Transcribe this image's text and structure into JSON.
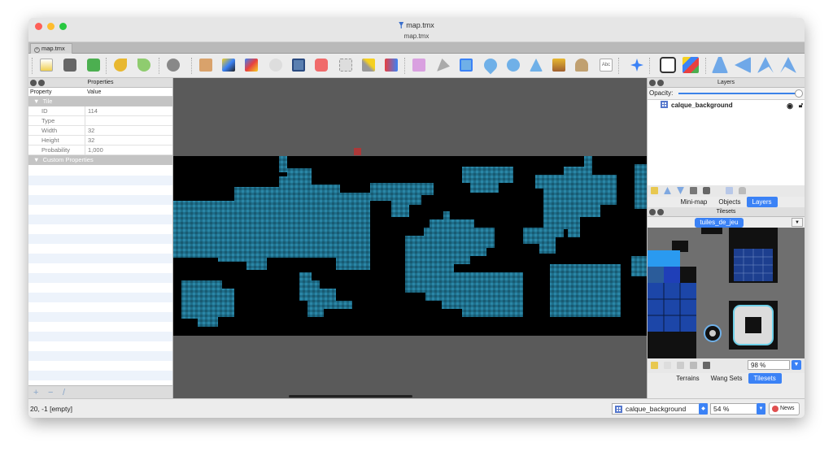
{
  "window": {
    "title": "map.tmx",
    "subtitle": "map.tmx",
    "document_tab": "map.tmx"
  },
  "properties": {
    "title": "Properties",
    "columns": [
      "Property",
      "Value"
    ],
    "group_tile": "Tile",
    "rows": [
      {
        "key": "ID",
        "value": "114"
      },
      {
        "key": "Type",
        "value": ""
      },
      {
        "key": "Width",
        "value": "32"
      },
      {
        "key": "Height",
        "value": "32"
      },
      {
        "key": "Probability",
        "value": "1,000"
      }
    ],
    "group_custom": "Custom Properties",
    "bottom_buttons": [
      "+",
      "−",
      "/"
    ]
  },
  "layers": {
    "title": "Layers",
    "opacity_label": "Opacity:",
    "items": [
      {
        "name": "calque_background"
      }
    ],
    "tabs": [
      "Mini-map",
      "Objects",
      "Layers"
    ],
    "selected_tab": "Layers"
  },
  "tilesets": {
    "title": "Tilesets",
    "active_tileset": "tuiles_de_jeu",
    "zoom": "98 %",
    "tabs": [
      "Terrains",
      "Wang Sets",
      "Tilesets"
    ],
    "selected_tab": "Tilesets"
  },
  "status": {
    "coords": "20, -1 [empty]",
    "current_layer": "calque_background",
    "zoom": "54 %",
    "news_label": "News"
  },
  "colors": {
    "accent": "#3b82f6",
    "tile_blue": "#1f6f8b",
    "map_background": "#000000",
    "canvas_background": "#5a5a5a"
  }
}
